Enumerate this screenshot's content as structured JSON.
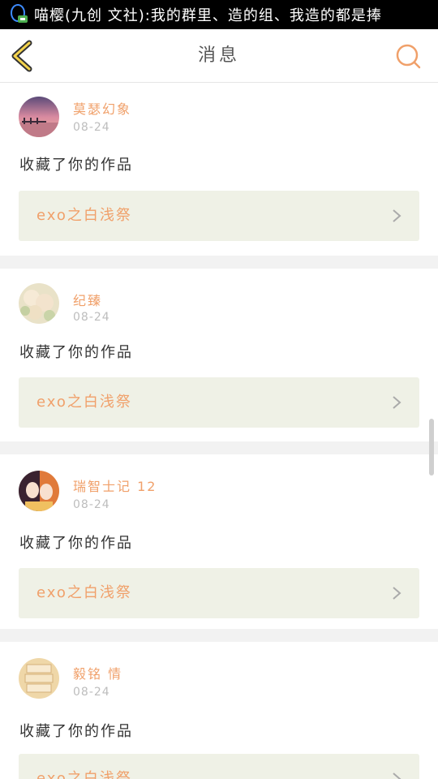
{
  "statusbar": {
    "ticker": "喵樱(九创 文社):我的群里、造的组、我造的都是捧"
  },
  "header": {
    "title": "消息"
  },
  "colors": {
    "accent": "#f0a06a",
    "card_bg": "#eff1e6",
    "separator": "#f2f2f2"
  },
  "feed": [
    {
      "name": "莫瑟幻象",
      "date": "08-24",
      "action": "收藏了你的作品",
      "work": "exo之白浅祭",
      "avatar": "sunset-pier-avatar"
    },
    {
      "name": "纪臻",
      "date": "08-24",
      "action": "收藏了你的作品",
      "work": "exo之白浅祭",
      "avatar": "flowers-avatar"
    },
    {
      "name": "瑞智士记 12",
      "date": "08-24",
      "action": "收藏了你的作品",
      "work": "exo之白浅祭",
      "avatar": "anime-girls-avatar"
    },
    {
      "name": "毅铭 情",
      "date": "08-24",
      "action": "收藏了你的作品",
      "work": "exo之白浅祭",
      "avatar": "books-avatar"
    }
  ]
}
